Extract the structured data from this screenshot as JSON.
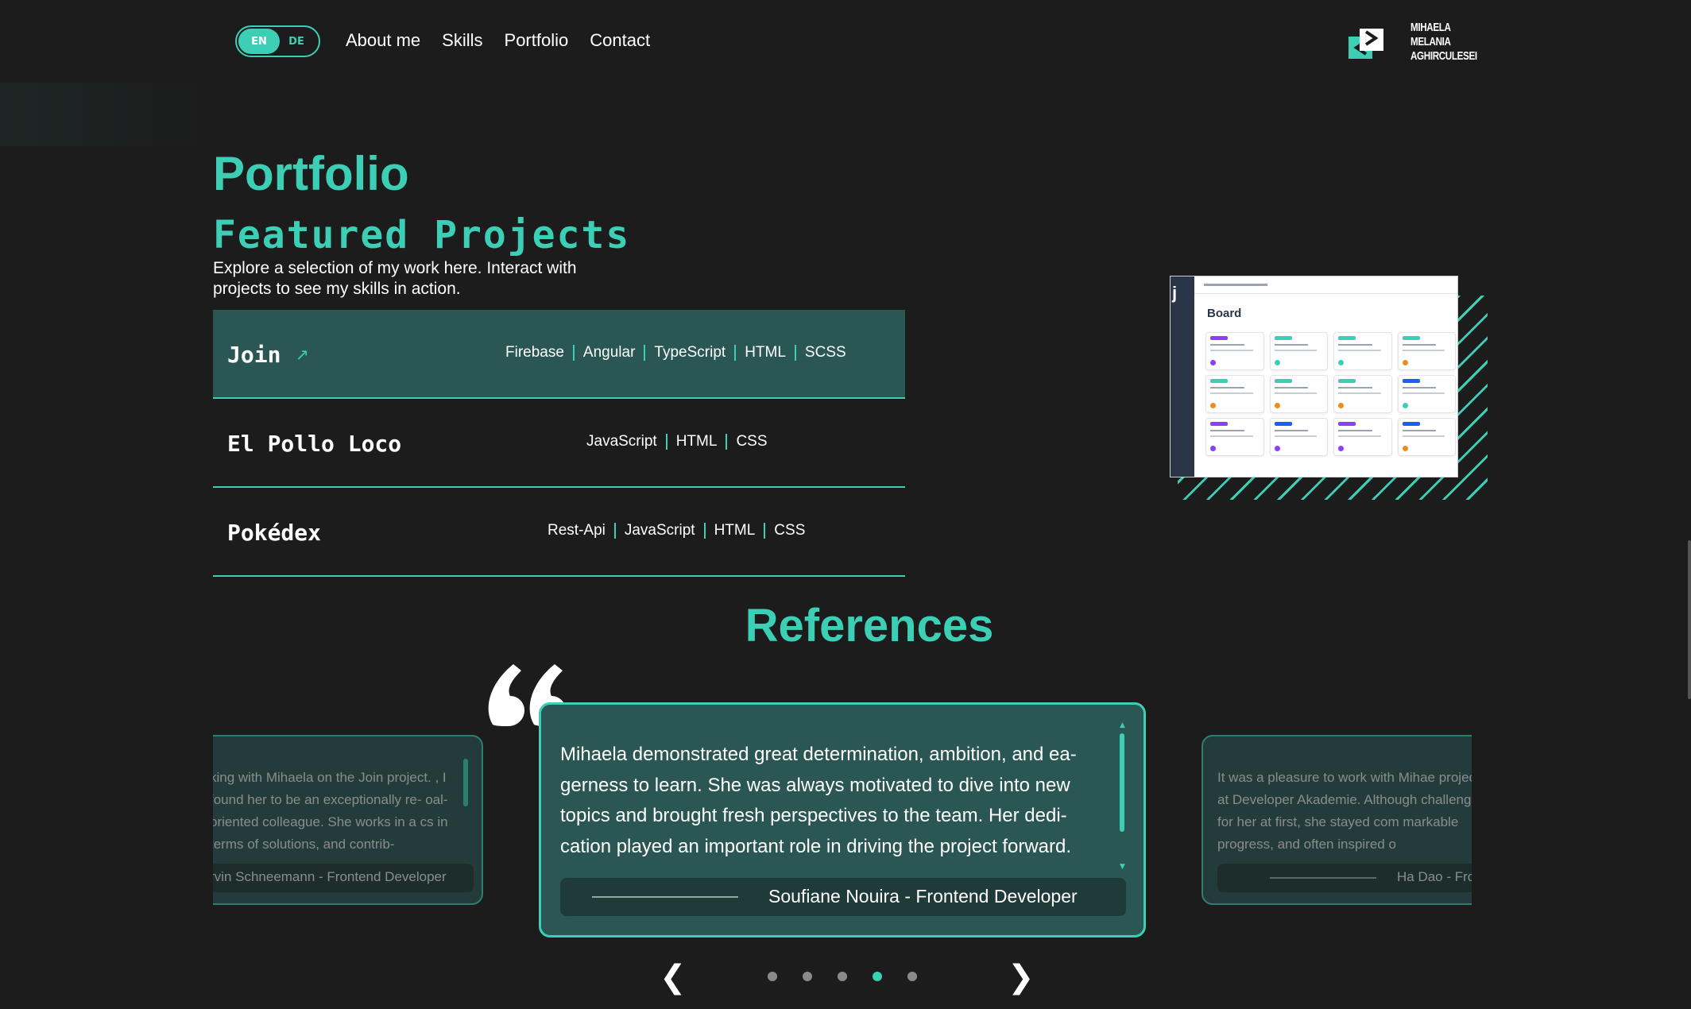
{
  "header": {
    "lang_en": "EN",
    "lang_de": "DE",
    "nav": [
      "About me",
      "Skills",
      "Portfolio",
      "Contact"
    ],
    "logo_name": [
      "MIHAELA",
      "MELANIA",
      "AGHIRCULESEI"
    ]
  },
  "portfolio": {
    "title": "Portfolio",
    "subtitle": "Featured Projects",
    "intro": "Explore a selection of my work here. Interact with projects to see my skills in action.",
    "arrow_icon": "↗",
    "projects": [
      {
        "name": "Join",
        "tech": [
          "Firebase",
          "Angular",
          "TypeScript",
          "HTML",
          "SCSS"
        ],
        "active": true
      },
      {
        "name": "El Pollo Loco",
        "tech": [
          "JavaScript",
          "HTML",
          "CSS"
        ],
        "active": false
      },
      {
        "name": "Pokédex",
        "tech": [
          "Rest-Api",
          "JavaScript",
          "HTML",
          "CSS"
        ],
        "active": false
      }
    ],
    "preview": {
      "board_title": "Board",
      "app_letter": "j"
    }
  },
  "references": {
    "title": "References",
    "left": {
      "text": "king with Mihaela on the Join project. , I found her to be an exceptionally re- oal-oriented colleague. She works in a cs in terms of solutions, and contrib-",
      "author": "rvin Schneemann - Frontend Developer"
    },
    "center": {
      "text": "Mihaela demonstrated great determination, ambition, and ea-gerness to learn. She was always motivated to dive into new topics and brought fresh perspectives to the team. Her dedi-cation played an important role in driving the project forward.",
      "author": "Soufiane Nouira - Frontend Developer"
    },
    "right": {
      "text": "It was a pleasure to work with Mihae project at Developer Akademie. Although challenge for her at first, she stayed com markable progress, and often inspired o",
      "author": "Ha Dao - Fro"
    },
    "prev_label": "❮",
    "next_label": "❯",
    "dots_count": 5,
    "active_dot": 3
  },
  "colors": {
    "accent": "#3dcfb6",
    "background": "#1c1c1c",
    "card": "#2a5653"
  }
}
